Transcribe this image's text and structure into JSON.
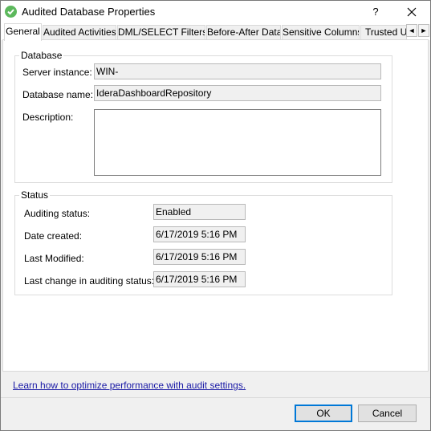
{
  "window": {
    "title": "Audited Database Properties",
    "help_label": "?"
  },
  "tabs": [
    {
      "label": "General"
    },
    {
      "label": "Audited Activities"
    },
    {
      "label": "DML/SELECT Filters"
    },
    {
      "label": "Before-After Data"
    },
    {
      "label": "Sensitive Columns"
    },
    {
      "label": "Trusted Us"
    }
  ],
  "tab_scroll": {
    "left": "◄",
    "right": "►"
  },
  "database_group": {
    "title": "Database",
    "server_instance_label": "Server instance:",
    "server_instance_value": "WIN-",
    "database_name_label": "Database name:",
    "database_name_value": "IderaDashboardRepository",
    "description_label": "Description:",
    "description_value": ""
  },
  "status_group": {
    "title": "Status",
    "auditing_status_label": "Auditing status:",
    "auditing_status_value": "Enabled",
    "date_created_label": "Date created:",
    "date_created_value": "6/17/2019 5:16 PM",
    "last_modified_label": "Last Modified:",
    "last_modified_value": "6/17/2019 5:16 PM",
    "last_change_label": "Last change in auditing status:",
    "last_change_value": "6/17/2019 5:16 PM"
  },
  "footer": {
    "link_text": "Learn how to optimize performance with audit settings.",
    "ok_label": "OK",
    "cancel_label": "Cancel"
  },
  "colors": {
    "app_icon": "#5cb85c",
    "link": "#1a1aa6",
    "default_button_border": "#0078d7"
  }
}
